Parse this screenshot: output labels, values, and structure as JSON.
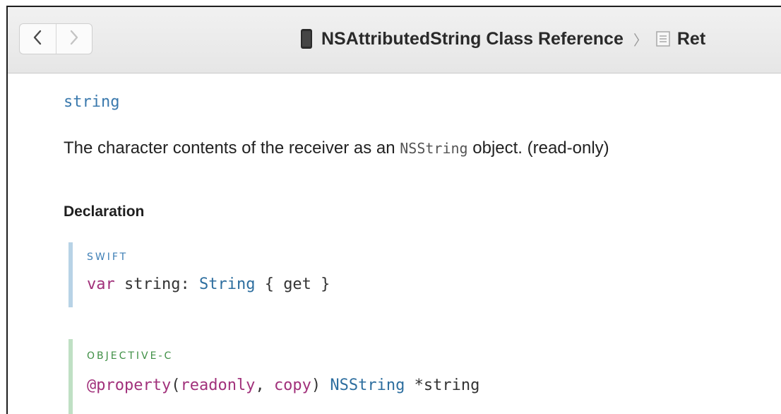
{
  "toolbar": {
    "back_icon": "chevron-left-icon",
    "forward_icon": "chevron-right-icon",
    "breadcrumb": {
      "current": "NSAttributedString Class Reference",
      "separator": "〉",
      "next_partial": "Ret"
    }
  },
  "property": {
    "name": "string",
    "summary_before": "The character contents of the receiver as an ",
    "summary_code": "NSString",
    "summary_after": " object. (read-only)"
  },
  "declaration": {
    "heading": "Declaration",
    "swift": {
      "label": "SWIFT",
      "kw_var": "var",
      "name": " string: ",
      "type": "String",
      "rest": " { get }"
    },
    "objc": {
      "label": "OBJECTIVE-C",
      "kw_property": "@property",
      "attrs_open": "(",
      "kw_readonly": "readonly",
      "comma": ", ",
      "kw_copy": "copy",
      "attrs_close": ") ",
      "type": "NSString",
      "rest": " *string"
    }
  },
  "colors": {
    "accent_link": "#3a79ad",
    "keyword": "#a1317b",
    "swift_bar": "#b8d3e6",
    "objc_bar": "#bfe0c4",
    "swift_label": "#3e7fb6",
    "objc_label": "#3f8f45"
  }
}
